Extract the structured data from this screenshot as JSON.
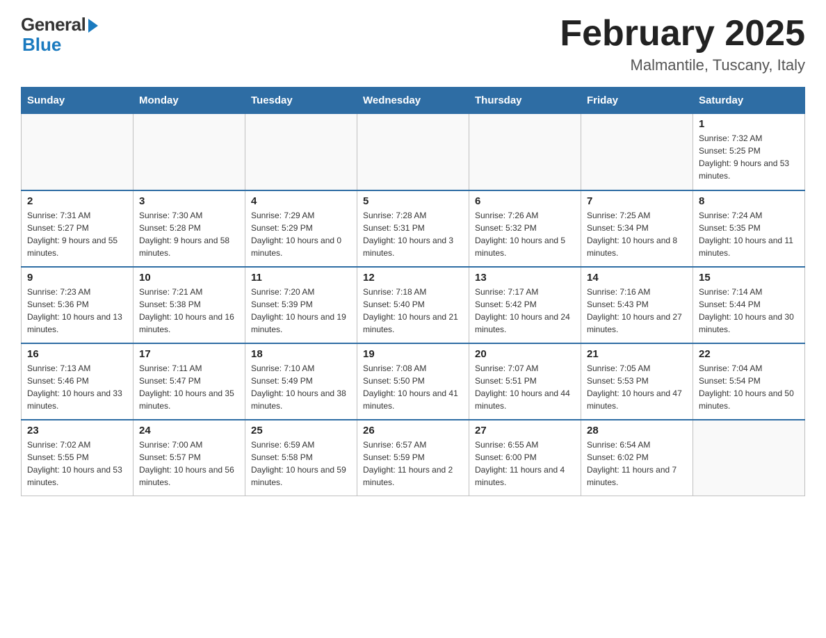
{
  "header": {
    "logo_general": "General",
    "logo_blue": "Blue",
    "month_title": "February 2025",
    "location": "Malmantile, Tuscany, Italy"
  },
  "weekdays": [
    "Sunday",
    "Monday",
    "Tuesday",
    "Wednesday",
    "Thursday",
    "Friday",
    "Saturday"
  ],
  "weeks": [
    [
      {
        "day": "",
        "info": ""
      },
      {
        "day": "",
        "info": ""
      },
      {
        "day": "",
        "info": ""
      },
      {
        "day": "",
        "info": ""
      },
      {
        "day": "",
        "info": ""
      },
      {
        "day": "",
        "info": ""
      },
      {
        "day": "1",
        "info": "Sunrise: 7:32 AM\nSunset: 5:25 PM\nDaylight: 9 hours and 53 minutes."
      }
    ],
    [
      {
        "day": "2",
        "info": "Sunrise: 7:31 AM\nSunset: 5:27 PM\nDaylight: 9 hours and 55 minutes."
      },
      {
        "day": "3",
        "info": "Sunrise: 7:30 AM\nSunset: 5:28 PM\nDaylight: 9 hours and 58 minutes."
      },
      {
        "day": "4",
        "info": "Sunrise: 7:29 AM\nSunset: 5:29 PM\nDaylight: 10 hours and 0 minutes."
      },
      {
        "day": "5",
        "info": "Sunrise: 7:28 AM\nSunset: 5:31 PM\nDaylight: 10 hours and 3 minutes."
      },
      {
        "day": "6",
        "info": "Sunrise: 7:26 AM\nSunset: 5:32 PM\nDaylight: 10 hours and 5 minutes."
      },
      {
        "day": "7",
        "info": "Sunrise: 7:25 AM\nSunset: 5:34 PM\nDaylight: 10 hours and 8 minutes."
      },
      {
        "day": "8",
        "info": "Sunrise: 7:24 AM\nSunset: 5:35 PM\nDaylight: 10 hours and 11 minutes."
      }
    ],
    [
      {
        "day": "9",
        "info": "Sunrise: 7:23 AM\nSunset: 5:36 PM\nDaylight: 10 hours and 13 minutes."
      },
      {
        "day": "10",
        "info": "Sunrise: 7:21 AM\nSunset: 5:38 PM\nDaylight: 10 hours and 16 minutes."
      },
      {
        "day": "11",
        "info": "Sunrise: 7:20 AM\nSunset: 5:39 PM\nDaylight: 10 hours and 19 minutes."
      },
      {
        "day": "12",
        "info": "Sunrise: 7:18 AM\nSunset: 5:40 PM\nDaylight: 10 hours and 21 minutes."
      },
      {
        "day": "13",
        "info": "Sunrise: 7:17 AM\nSunset: 5:42 PM\nDaylight: 10 hours and 24 minutes."
      },
      {
        "day": "14",
        "info": "Sunrise: 7:16 AM\nSunset: 5:43 PM\nDaylight: 10 hours and 27 minutes."
      },
      {
        "day": "15",
        "info": "Sunrise: 7:14 AM\nSunset: 5:44 PM\nDaylight: 10 hours and 30 minutes."
      }
    ],
    [
      {
        "day": "16",
        "info": "Sunrise: 7:13 AM\nSunset: 5:46 PM\nDaylight: 10 hours and 33 minutes."
      },
      {
        "day": "17",
        "info": "Sunrise: 7:11 AM\nSunset: 5:47 PM\nDaylight: 10 hours and 35 minutes."
      },
      {
        "day": "18",
        "info": "Sunrise: 7:10 AM\nSunset: 5:49 PM\nDaylight: 10 hours and 38 minutes."
      },
      {
        "day": "19",
        "info": "Sunrise: 7:08 AM\nSunset: 5:50 PM\nDaylight: 10 hours and 41 minutes."
      },
      {
        "day": "20",
        "info": "Sunrise: 7:07 AM\nSunset: 5:51 PM\nDaylight: 10 hours and 44 minutes."
      },
      {
        "day": "21",
        "info": "Sunrise: 7:05 AM\nSunset: 5:53 PM\nDaylight: 10 hours and 47 minutes."
      },
      {
        "day": "22",
        "info": "Sunrise: 7:04 AM\nSunset: 5:54 PM\nDaylight: 10 hours and 50 minutes."
      }
    ],
    [
      {
        "day": "23",
        "info": "Sunrise: 7:02 AM\nSunset: 5:55 PM\nDaylight: 10 hours and 53 minutes."
      },
      {
        "day": "24",
        "info": "Sunrise: 7:00 AM\nSunset: 5:57 PM\nDaylight: 10 hours and 56 minutes."
      },
      {
        "day": "25",
        "info": "Sunrise: 6:59 AM\nSunset: 5:58 PM\nDaylight: 10 hours and 59 minutes."
      },
      {
        "day": "26",
        "info": "Sunrise: 6:57 AM\nSunset: 5:59 PM\nDaylight: 11 hours and 2 minutes."
      },
      {
        "day": "27",
        "info": "Sunrise: 6:55 AM\nSunset: 6:00 PM\nDaylight: 11 hours and 4 minutes."
      },
      {
        "day": "28",
        "info": "Sunrise: 6:54 AM\nSunset: 6:02 PM\nDaylight: 11 hours and 7 minutes."
      },
      {
        "day": "",
        "info": ""
      }
    ]
  ]
}
